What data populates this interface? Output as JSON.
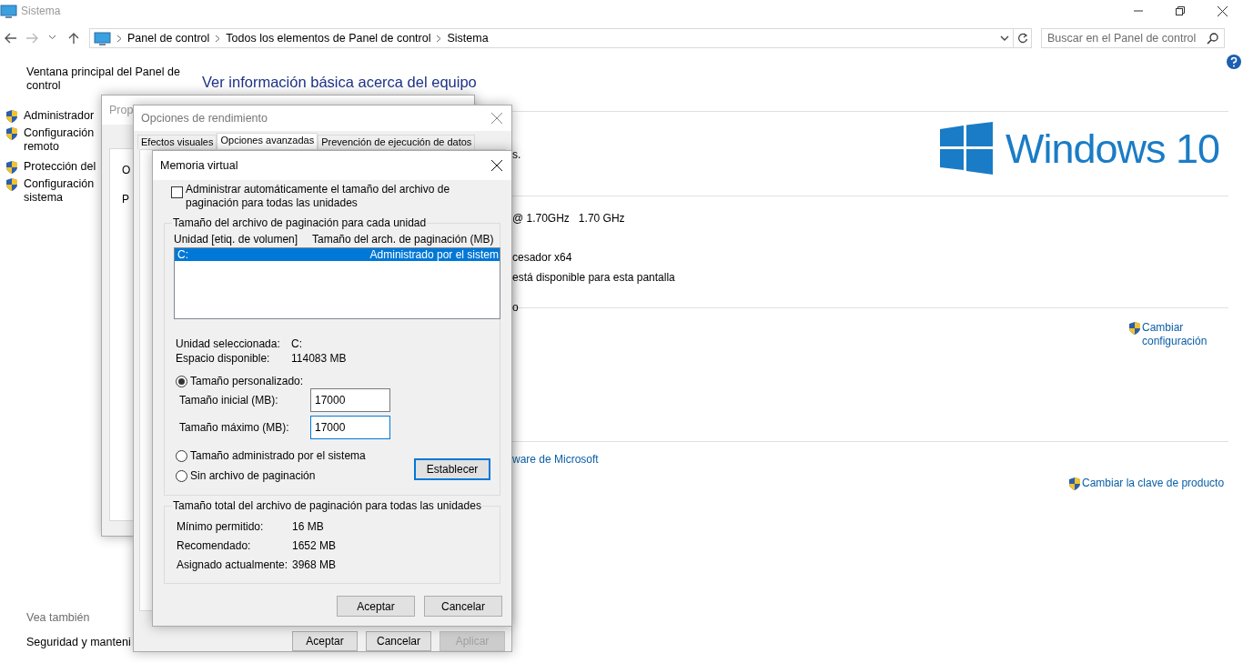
{
  "window": {
    "title": "Sistema"
  },
  "nav": {
    "breadcrumb": [
      "Panel de control",
      "Todos los elementos de Panel de control",
      "Sistema"
    ],
    "search": {
      "placeholder": "Buscar en el Panel de control"
    }
  },
  "sidebar": {
    "home": "Ventana principal del Panel de control",
    "items": [
      {
        "lines": [
          "Administrador"
        ]
      },
      {
        "lines": [
          "Configuración",
          "remoto"
        ]
      },
      {
        "lines": [
          "Protección del"
        ]
      },
      {
        "lines": [
          "Configuración",
          "sistema"
        ]
      }
    ],
    "see_also": {
      "title": "Vea también",
      "items": [
        "Seguridad y manteni"
      ]
    }
  },
  "main": {
    "heading": "Ver información básica acerca del equipo",
    "logo_text": "Windows 10",
    "fragments": [
      {
        "kind": "text",
        "text": "s."
      },
      {
        "kind": "text",
        "text": "@ 1.70GHz   1.70 GHz"
      },
      {
        "kind": "text",
        "text": "cesador x64"
      },
      {
        "kind": "text",
        "text": "está disponible para esta pantalla"
      },
      {
        "kind": "text",
        "text": "o"
      },
      {
        "kind": "link",
        "text": "ware de Microsoft"
      }
    ],
    "shield_links": [
      {
        "lines": [
          "Cambiar",
          "configuración"
        ]
      },
      {
        "lines": [
          "Cambiar la clave de producto"
        ]
      }
    ]
  },
  "system_properties": {
    "title": "Prop",
    "fragments": [
      "O",
      "P"
    ]
  },
  "performance": {
    "title": "Opciones de rendimiento",
    "tabs": [
      {
        "label": "Efectos visuales",
        "selected": false
      },
      {
        "label": "Opciones avanzadas",
        "selected": true
      },
      {
        "label": "Prevención de ejecución de datos",
        "selected": false
      }
    ],
    "buttons": [
      {
        "label": "Aceptar",
        "disabled": false
      },
      {
        "label": "Cancelar",
        "disabled": false
      },
      {
        "label": "Aplicar",
        "disabled": true
      }
    ]
  },
  "virtual_memory": {
    "title": "Memoria virtual",
    "auto_manage": {
      "label": "Administrar automáticamente el tamaño del archivo de paginación para todas las unidades",
      "checked": false
    },
    "per_drive": {
      "title": "Tamaño del archivo de paginación para cada unidad",
      "columns": [
        "Unidad [etiq. de volumen]",
        "Tamaño del arch. de paginación (MB)"
      ],
      "rows": [
        {
          "drive": "C:",
          "size": "Administrado por el sistem",
          "selected": true
        }
      ],
      "info": [
        {
          "label": "Unidad seleccionada:",
          "value": "C:"
        },
        {
          "label": "Espacio disponible:",
          "value": "114083 MB"
        }
      ],
      "options": [
        {
          "label": "Tamaño personalizado:",
          "selected": true
        },
        {
          "label": "Tamaño administrado por el sistema",
          "selected": false
        },
        {
          "label": "Sin archivo de paginación",
          "selected": false
        }
      ],
      "fields": [
        {
          "label": "Tamaño inicial (MB):",
          "value": "17000",
          "focused": false
        },
        {
          "label": "Tamaño máximo (MB):",
          "value": "17000",
          "focused": true
        }
      ],
      "set_button": "Establecer"
    },
    "totals": {
      "title": "Tamaño total del archivo de paginación para todas las unidades",
      "rows": [
        {
          "label": "Mínimo permitido:",
          "value": "16 MB"
        },
        {
          "label": "Recomendado:",
          "value": "1652 MB"
        },
        {
          "label": "Asignado actualmente:",
          "value": "3968 MB"
        }
      ]
    },
    "buttons": [
      {
        "label": "Aceptar"
      },
      {
        "label": "Cancelar"
      }
    ]
  }
}
